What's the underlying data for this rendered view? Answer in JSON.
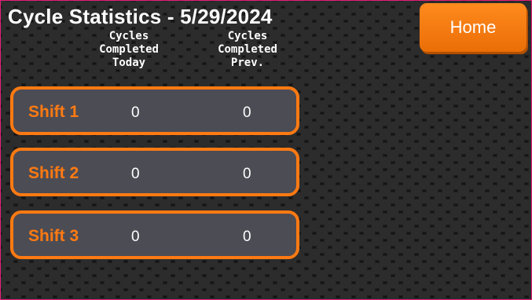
{
  "header": {
    "title": "Cycle Statistics - 5/29/2024",
    "home_label": "Home"
  },
  "columns": {
    "today": "Cycles\nCompleted\nToday",
    "prev": "Cycles\nCompleted\nPrev."
  },
  "shifts": [
    {
      "label": "Shift 1",
      "today": "0",
      "prev": "0"
    },
    {
      "label": "Shift 2",
      "today": "0",
      "prev": "0"
    },
    {
      "label": "Shift 3",
      "today": "0",
      "prev": "0"
    }
  ],
  "colors": {
    "accent": "#ff7a12",
    "row_fill": "#4c4c54",
    "background": "#141414"
  }
}
